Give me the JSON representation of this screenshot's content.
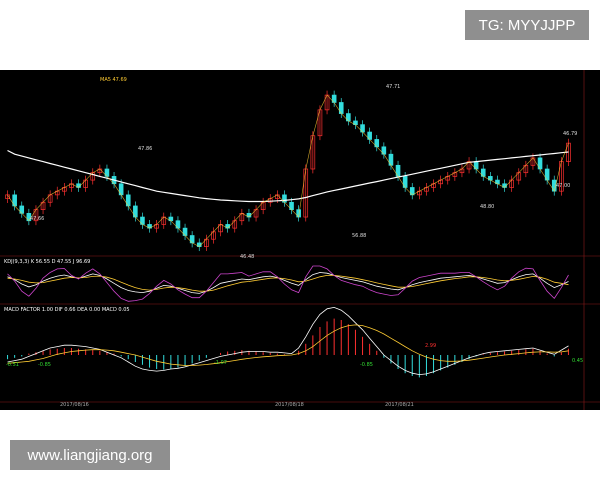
{
  "watermark_top": "TG: MYYJJPP",
  "watermark_bottom": "www.liangjiang.org",
  "colors": {
    "up": "#ff3030",
    "down": "#33dddd",
    "ma_long": "#ffffff",
    "kdj_k": "#ffffff",
    "kdj_d": "#ffcc33",
    "kdj_j": "#cc44cc"
  },
  "main_panel": {
    "header_small": "MA5 47.69",
    "price_labels": [
      "47.86",
      "47.66",
      "46.48",
      "56.88",
      "47.71",
      "48.80",
      "46.79",
      "47.00"
    ]
  },
  "kdj_panel": {
    "header": "KDJ(9,3,3)  K  56.55   D  47.55   J  96.69"
  },
  "macd_panel": {
    "header": "MACD  FACTOR  1.00   DIF  0.66   DEA  0.00   MACD  0.05",
    "labels": [
      "-0.51",
      "-0.85",
      "-1.07",
      "-0.85",
      "2.99",
      "0.45"
    ]
  },
  "x_dates": [
    "2017/08/16",
    "2017/08/18",
    "2017/08/21"
  ],
  "chart_data": {
    "type": "line",
    "title": "",
    "x": [
      1,
      2,
      3,
      4,
      5,
      6,
      7,
      8,
      9,
      10,
      11,
      12,
      13,
      14,
      15,
      16,
      17,
      18,
      19,
      20,
      21,
      22,
      23,
      24,
      25,
      26,
      27,
      28,
      29,
      30,
      31,
      32,
      33,
      34,
      35,
      36,
      37,
      38,
      39,
      40,
      41,
      42,
      43,
      44,
      45,
      46,
      47,
      48,
      49,
      50,
      51,
      52,
      53,
      54,
      55,
      56,
      57,
      58,
      59,
      60,
      61,
      62,
      63,
      64,
      65,
      66,
      67,
      68,
      69,
      70,
      71,
      72,
      73,
      74,
      75,
      76,
      77,
      78,
      79,
      80
    ],
    "series": [
      {
        "name": "close",
        "values": [
          47.9,
          47.6,
          47.4,
          47.2,
          47.5,
          47.7,
          47.9,
          48.0,
          48.1,
          48.2,
          48.1,
          48.3,
          48.5,
          48.6,
          48.4,
          48.2,
          47.9,
          47.6,
          47.3,
          47.1,
          47.0,
          47.1,
          47.3,
          47.2,
          47.0,
          46.8,
          46.6,
          46.5,
          46.7,
          46.9,
          47.1,
          47.0,
          47.2,
          47.4,
          47.3,
          47.5,
          47.7,
          47.8,
          47.9,
          47.7,
          47.5,
          47.3,
          48.6,
          49.5,
          50.2,
          50.6,
          50.4,
          50.1,
          49.9,
          49.8,
          49.6,
          49.4,
          49.2,
          49.0,
          48.7,
          48.4,
          48.1,
          47.9,
          48.0,
          48.1,
          48.2,
          48.3,
          48.4,
          48.5,
          48.6,
          48.8,
          48.6,
          48.4,
          48.3,
          48.2,
          48.1,
          48.3,
          48.5,
          48.7,
          48.9,
          48.6,
          48.3,
          48.0,
          48.8,
          49.3
        ]
      },
      {
        "name": "ma_long",
        "values": [
          49.1,
          49.0,
          48.95,
          48.9,
          48.85,
          48.8,
          48.75,
          48.7,
          48.65,
          48.6,
          48.55,
          48.5,
          48.45,
          48.4,
          48.35,
          48.3,
          48.25,
          48.2,
          48.15,
          48.1,
          48.05,
          48.0,
          47.97,
          47.94,
          47.91,
          47.88,
          47.85,
          47.82,
          47.8,
          47.78,
          47.76,
          47.75,
          47.74,
          47.73,
          47.72,
          47.72,
          47.72,
          47.73,
          47.74,
          47.75,
          47.77,
          47.79,
          47.83,
          47.88,
          47.93,
          47.98,
          48.02,
          48.06,
          48.1,
          48.14,
          48.18,
          48.22,
          48.26,
          48.3,
          48.34,
          48.38,
          48.42,
          48.46,
          48.5,
          48.54,
          48.58,
          48.62,
          48.66,
          48.7,
          48.74,
          48.78,
          48.8,
          48.82,
          48.84,
          48.86,
          48.88,
          48.9,
          48.92,
          48.94,
          48.96,
          48.98,
          49.0,
          49.02,
          49.04,
          49.06
        ]
      }
    ],
    "ylim": [
      46.3,
      50.9
    ],
    "kdj": {
      "k": [
        70,
        62,
        50,
        42,
        48,
        58,
        66,
        72,
        75,
        70,
        66,
        72,
        78,
        74,
        64,
        52,
        40,
        32,
        28,
        26,
        30,
        38,
        46,
        44,
        38,
        32,
        26,
        24,
        30,
        40,
        52,
        56,
        60,
        64,
        62,
        66,
        70,
        72,
        68,
        60,
        52,
        46,
        62,
        76,
        82,
        80,
        74,
        68,
        64,
        60,
        56,
        50,
        44,
        40,
        36,
        34,
        40,
        48,
        54,
        58,
        62,
        66,
        68,
        70,
        72,
        74,
        70,
        64,
        58,
        52,
        54,
        62,
        70,
        76,
        78,
        66,
        52,
        40,
        48,
        57
      ],
      "d": [
        66,
        64,
        60,
        55,
        53,
        54,
        58,
        62,
        66,
        68,
        67,
        68,
        71,
        72,
        69,
        63,
        55,
        47,
        40,
        35,
        33,
        35,
        39,
        41,
        40,
        37,
        33,
        30,
        30,
        33,
        39,
        45,
        50,
        55,
        57,
        60,
        63,
        66,
        67,
        65,
        61,
        56,
        58,
        64,
        70,
        74,
        74,
        72,
        69,
        66,
        62,
        58,
        53,
        49,
        45,
        41,
        41,
        43,
        47,
        51,
        55,
        59,
        62,
        65,
        67,
        70,
        70,
        68,
        65,
        61,
        59,
        60,
        63,
        67,
        71,
        69,
        63,
        55,
        52,
        48
      ]
    },
    "macd": {
      "hist": [
        -0.3,
        -0.2,
        -0.1,
        0.1,
        0.2,
        0.3,
        0.4,
        0.45,
        0.5,
        0.5,
        0.45,
        0.4,
        0.35,
        0.3,
        0.2,
        0.1,
        -0.1,
        -0.3,
        -0.5,
        -0.7,
        -0.9,
        -1.0,
        -1.05,
        -1.0,
        -0.9,
        -0.8,
        -0.6,
        -0.4,
        -0.2,
        0.0,
        0.15,
        0.25,
        0.3,
        0.35,
        0.3,
        0.25,
        0.2,
        0.15,
        0.1,
        0.05,
        0.0,
        0.3,
        0.8,
        1.4,
        2.0,
        2.4,
        2.6,
        2.5,
        2.2,
        1.8,
        1.3,
        0.8,
        0.3,
        -0.2,
        -0.6,
        -1.0,
        -1.3,
        -1.5,
        -1.6,
        -1.5,
        -1.3,
        -1.1,
        -0.9,
        -0.7,
        -0.5,
        -0.3,
        -0.1,
        0.05,
        0.15,
        0.2,
        0.25,
        0.3,
        0.35,
        0.4,
        0.45,
        0.3,
        0.1,
        -0.1,
        0.2,
        0.45
      ],
      "dif": [
        -0.5,
        -0.4,
        -0.3,
        -0.1,
        0.1,
        0.3,
        0.5,
        0.6,
        0.7,
        0.7,
        0.65,
        0.6,
        0.5,
        0.4,
        0.2,
        0.0,
        -0.2,
        -0.5,
        -0.8,
        -1.0,
        -1.1,
        -1.15,
        -1.1,
        -1.0,
        -0.95,
        -0.85,
        -0.7,
        -0.55,
        -0.4,
        -0.25,
        -0.1,
        0.0,
        0.1,
        0.2,
        0.25,
        0.25,
        0.25,
        0.2,
        0.2,
        0.15,
        0.1,
        0.5,
        1.3,
        2.2,
        2.9,
        3.3,
        3.4,
        3.2,
        2.8,
        2.3,
        1.8,
        1.2,
        0.6,
        0.0,
        -0.4,
        -0.8,
        -1.1,
        -1.3,
        -1.4,
        -1.35,
        -1.2,
        -1.0,
        -0.8,
        -0.6,
        -0.4,
        -0.2,
        -0.05,
        0.1,
        0.2,
        0.25,
        0.3,
        0.35,
        0.4,
        0.45,
        0.5,
        0.35,
        0.2,
        0.05,
        0.35,
        0.65
      ],
      "dea": [
        -0.6,
        -0.55,
        -0.5,
        -0.45,
        -0.35,
        -0.25,
        -0.1,
        0.05,
        0.15,
        0.25,
        0.3,
        0.35,
        0.38,
        0.38,
        0.35,
        0.3,
        0.2,
        0.1,
        0.0,
        -0.15,
        -0.3,
        -0.45,
        -0.55,
        -0.65,
        -0.7,
        -0.75,
        -0.75,
        -0.72,
        -0.68,
        -0.62,
        -0.55,
        -0.47,
        -0.39,
        -0.31,
        -0.24,
        -0.18,
        -0.13,
        -0.09,
        -0.05,
        -0.02,
        0.0,
        0.1,
        0.3,
        0.6,
        1.0,
        1.4,
        1.7,
        1.95,
        2.1,
        2.15,
        2.1,
        1.95,
        1.75,
        1.5,
        1.2,
        0.9,
        0.6,
        0.3,
        0.05,
        -0.15,
        -0.3,
        -0.4,
        -0.45,
        -0.45,
        -0.42,
        -0.37,
        -0.3,
        -0.22,
        -0.14,
        -0.07,
        0.0,
        0.05,
        0.1,
        0.15,
        0.2,
        0.22,
        0.22,
        0.2,
        0.22,
        0.3
      ]
    }
  }
}
